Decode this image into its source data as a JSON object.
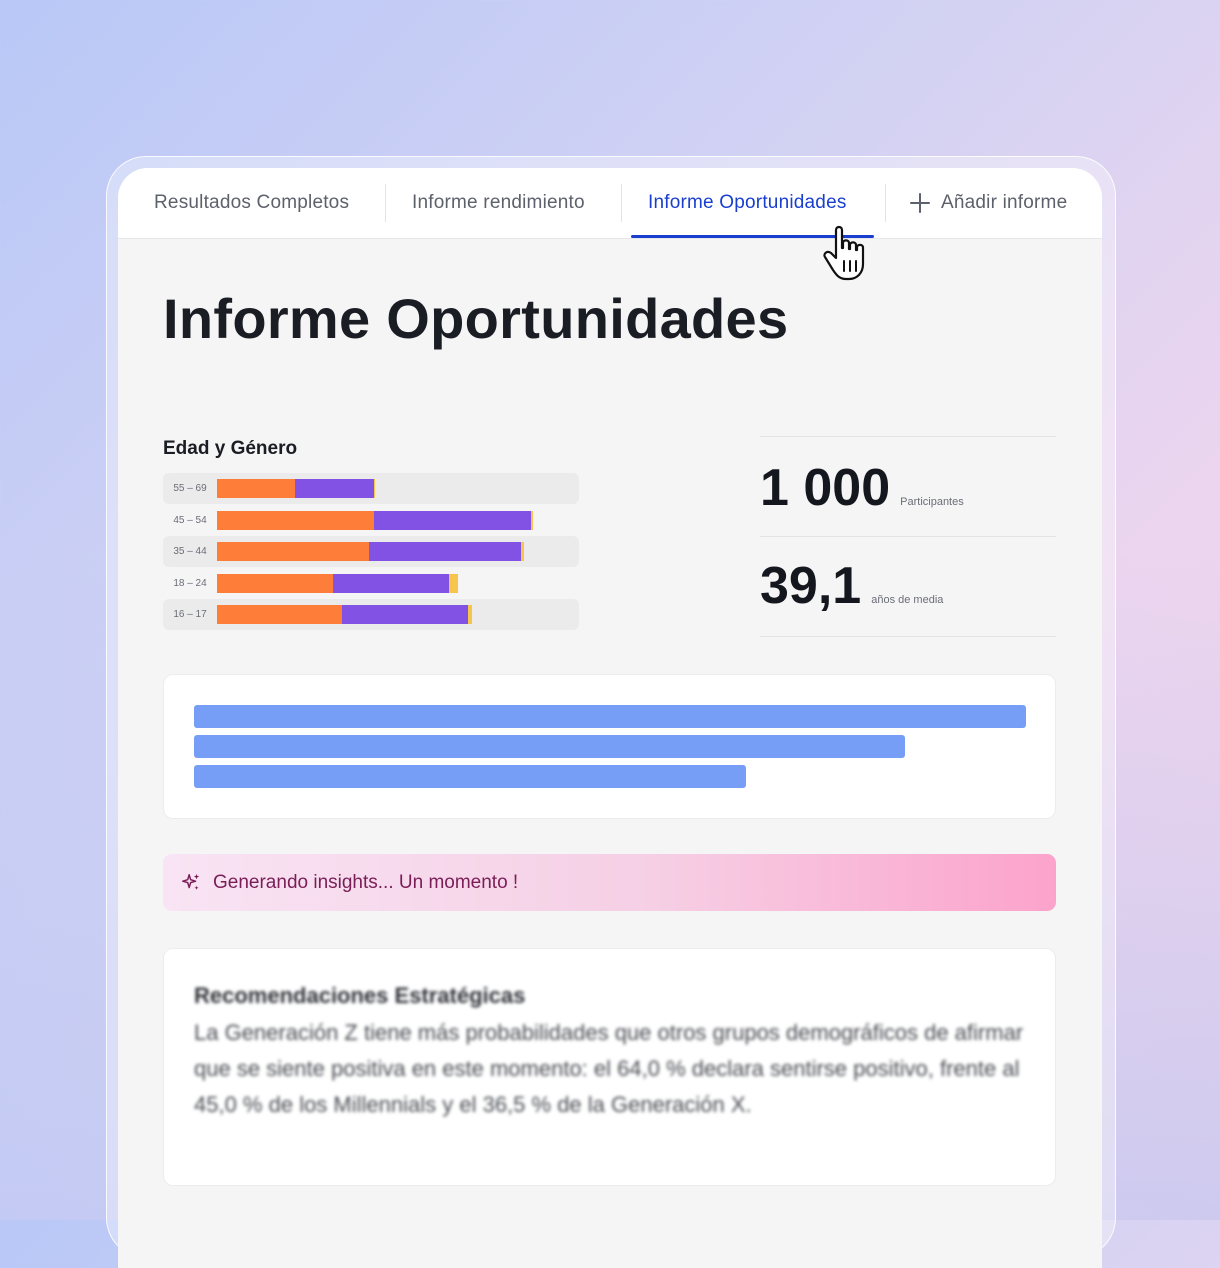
{
  "tabs": [
    {
      "label": "Resultados Completos",
      "active": false
    },
    {
      "label": "Informe rendimiento",
      "active": false
    },
    {
      "label": "Informe Oportunidades",
      "active": true
    },
    {
      "label": "Añadir informe",
      "active": false,
      "icon": "plus-icon"
    }
  ],
  "page": {
    "title": "Informe Oportunidades"
  },
  "age_gender": {
    "title": "Edad y Género",
    "colors": {
      "segment_1": "#fe7e39",
      "segment_2": "#8252e4",
      "segment_3": "#f8c54b"
    }
  },
  "chart_data": {
    "type": "bar",
    "orientation": "horizontal",
    "stacked": true,
    "title": "Edad y Género",
    "categories": [
      "55 – 69",
      "45 – 54",
      "35 – 44",
      "18 – 24",
      "16 – 17"
    ],
    "series": [
      {
        "values": [
          78,
          157,
          152,
          116,
          125
        ]
      },
      {
        "values": [
          79,
          157,
          152,
          116,
          126
        ]
      },
      {
        "values": [
          1,
          2,
          3,
          9,
          4
        ]
      }
    ],
    "xlim": [
      0,
      362
    ],
    "legend": "none",
    "grid": false
  },
  "stats": [
    {
      "value": "1 000",
      "label": "Participantes"
    },
    {
      "value": "39,1",
      "label": "años de media"
    }
  ],
  "insight_banner": {
    "text": "Generando insights... Un momento !",
    "icon": "sparkle-icon"
  },
  "recommendations": {
    "title": "Recomendaciones Estratégicas",
    "text": "La Generación Z tiene más probabilidades que otros grupos demográficos de afirmar que se siente positiva en este momento: el 64,0 % declara sentirse positivo, frente al 45,0 % de los Millennials y el 36,5 % de la Generación X."
  },
  "cursor": {
    "icon": "hand-pointer-icon"
  }
}
